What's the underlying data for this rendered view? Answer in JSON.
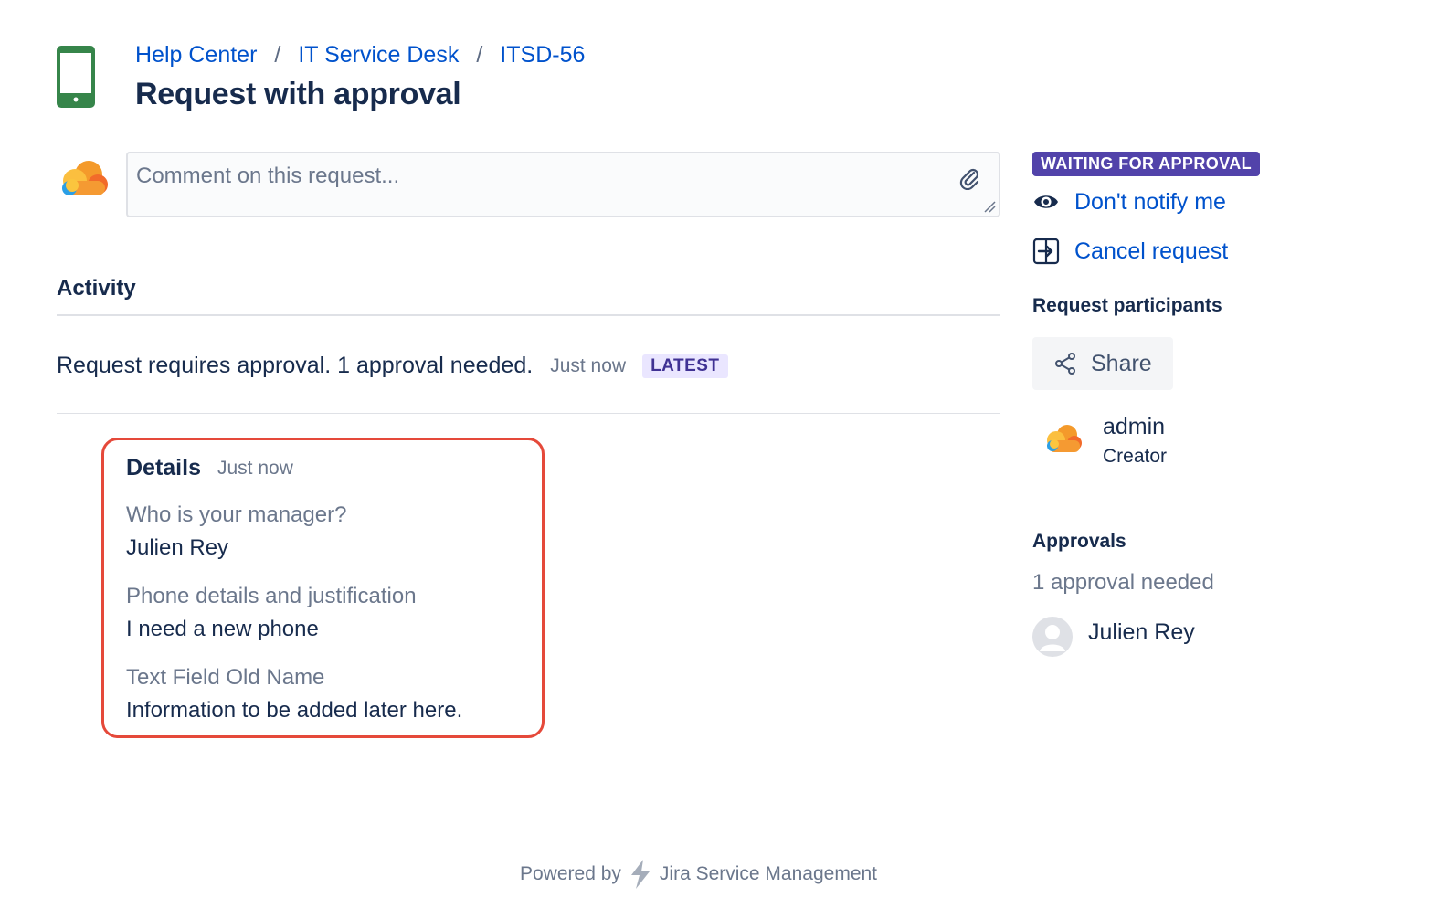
{
  "breadcrumb": {
    "items": [
      "Help Center",
      "IT Service Desk",
      "ITSD-56"
    ],
    "separator": "/"
  },
  "page_title": "Request with approval",
  "comment": {
    "placeholder": "Comment on this request..."
  },
  "activity": {
    "heading": "Activity",
    "message": "Request requires approval. 1 approval needed.",
    "time": "Just now",
    "badge": "LATEST"
  },
  "details": {
    "title": "Details",
    "time": "Just now",
    "fields": [
      {
        "label": "Who is your manager?",
        "value": "Julien Rey"
      },
      {
        "label": "Phone details and justification",
        "value": "I need a new phone"
      },
      {
        "label": "Text Field Old Name",
        "value": "Information to be added later here."
      }
    ]
  },
  "sidebar": {
    "status": "WAITING FOR APPROVAL",
    "notify_label": "Don't notify me",
    "cancel_label": "Cancel request",
    "participants_heading": "Request participants",
    "share_label": "Share",
    "participant": {
      "name": "admin",
      "role": "Creator"
    },
    "approvals_heading": "Approvals",
    "approvals_needed": "1 approval needed",
    "approver": "Julien Rey"
  },
  "footer": {
    "powered_by": "Powered by",
    "product": "Jira Service Management"
  },
  "colors": {
    "link": "#0052cc",
    "status_lozenge": "#5243aa",
    "latest_badge_bg": "#eae6ff",
    "highlight_border": "#e5493a",
    "portal_icon": "#36854a"
  },
  "icons": {
    "portal": "mobile-phone-icon",
    "attach": "paperclip-icon",
    "notify": "eye-icon",
    "cancel": "sign-out-icon",
    "share": "share-icon",
    "footer": "lightning-bolt-icon"
  }
}
